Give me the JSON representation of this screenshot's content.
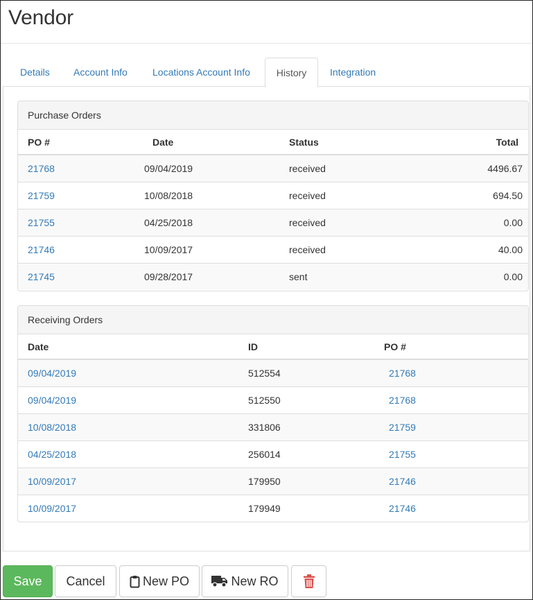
{
  "page": {
    "title": "Vendor"
  },
  "tabs": [
    {
      "label": "Details"
    },
    {
      "label": "Account Info"
    },
    {
      "label": "Locations Account Info"
    },
    {
      "label": "History",
      "active": true
    },
    {
      "label": "Integration"
    }
  ],
  "purchase_orders": {
    "heading": "Purchase Orders",
    "columns": [
      "PO #",
      "Date",
      "Status",
      "Total"
    ],
    "rows": [
      {
        "po": "21768",
        "date": "09/04/2019",
        "status": "received",
        "total": "4496.67"
      },
      {
        "po": "21759",
        "date": "10/08/2018",
        "status": "received",
        "total": "694.50"
      },
      {
        "po": "21755",
        "date": "04/25/2018",
        "status": "received",
        "total": "0.00"
      },
      {
        "po": "21746",
        "date": "10/09/2017",
        "status": "received",
        "total": "40.00"
      },
      {
        "po": "21745",
        "date": "09/28/2017",
        "status": "sent",
        "total": "0.00"
      }
    ]
  },
  "receiving_orders": {
    "heading": "Receiving Orders",
    "columns": [
      "Date",
      "ID",
      "PO #"
    ],
    "rows": [
      {
        "date": "09/04/2019",
        "id": "512554",
        "po": "21768"
      },
      {
        "date": "09/04/2019",
        "id": "512550",
        "po": "21768"
      },
      {
        "date": "10/08/2018",
        "id": "331806",
        "po": "21759"
      },
      {
        "date": "04/25/2018",
        "id": "256014",
        "po": "21755"
      },
      {
        "date": "10/09/2017",
        "id": "179950",
        "po": "21746"
      },
      {
        "date": "10/09/2017",
        "id": "179949",
        "po": "21746"
      }
    ]
  },
  "actions": {
    "save_label": "Save",
    "cancel_label": "Cancel",
    "new_po_label": "New PO",
    "new_ro_label": "New RO",
    "new_po_icon": "clipboard-icon",
    "new_ro_icon": "truck-icon",
    "delete_icon": "trash-icon"
  },
  "colors": {
    "link": "#337ab7",
    "save": "#5cb85c",
    "delete": "#d9534f"
  }
}
